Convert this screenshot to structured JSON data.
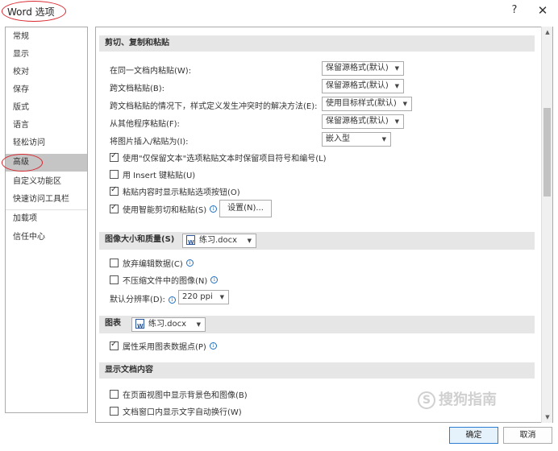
{
  "window": {
    "title": "Word 选项",
    "help_label": "?",
    "close_label": "✕"
  },
  "nav": {
    "items": [
      {
        "label": "常规"
      },
      {
        "label": "显示"
      },
      {
        "label": "校对"
      },
      {
        "label": "保存"
      },
      {
        "label": "版式"
      },
      {
        "label": "语言"
      },
      {
        "label": "轻松访问"
      },
      {
        "label": "高级",
        "selected": true
      },
      {
        "label": "自定义功能区"
      },
      {
        "label": "快速访问工具栏"
      },
      {
        "label": "加载项"
      },
      {
        "label": "信任中心"
      }
    ]
  },
  "cutpaste": {
    "header": "剪切、复制和粘贴",
    "rows": [
      {
        "label": "在同一文档内粘贴(W):",
        "value": "保留源格式(默认)"
      },
      {
        "label": "跨文档粘贴(B):",
        "value": "保留源格式(默认)"
      },
      {
        "label": "跨文档粘贴的情况下，样式定义发生冲突时的解决方法(E):",
        "value": "使用目标样式(默认)"
      },
      {
        "label": "从其他程序粘贴(F):",
        "value": "保留源格式(默认)"
      },
      {
        "label": "将图片插入/粘贴为(I):",
        "value": "嵌入型"
      }
    ],
    "checks": [
      {
        "label": "使用\"仅保留文本\"选项粘贴文本时保留项目符号和编号(L)",
        "checked": true
      },
      {
        "label": "用 Insert 键粘贴(U)",
        "checked": false
      },
      {
        "label": "粘贴内容时显示粘贴选项按钮(O)",
        "checked": true
      },
      {
        "label": "使用智能剪切和粘贴(S)",
        "checked": true
      }
    ],
    "settings_label": "设置(N)..."
  },
  "image": {
    "header": "图像大小和质量(S)",
    "doc": "练习.docx",
    "checks": [
      {
        "label": "放弃编辑数据(C)",
        "checked": false
      },
      {
        "label": "不压缩文件中的图像(N)",
        "checked": false
      }
    ],
    "resolution_label": "默认分辨率(D):",
    "resolution_value": "220 ppi"
  },
  "chart": {
    "header": "图表",
    "doc": "练习.docx",
    "checks": [
      {
        "label": "属性采用图表数据点(P)",
        "checked": true
      }
    ]
  },
  "display": {
    "header": "显示文档内容",
    "checks": [
      {
        "label": "在页面视图中显示背景色和图像(B)",
        "checked": false
      },
      {
        "label": "文档窗口内显示文字自动换行(W)",
        "checked": false
      }
    ]
  },
  "watermark": {
    "text": "搜狗指南",
    "logo": "S"
  },
  "footer": {
    "ok_label": "确定",
    "cancel_label": "取消"
  },
  "icons": {
    "info": "info-icon",
    "doc": "word-document-icon",
    "dropdown": "chevron-down-icon"
  },
  "colors": {
    "highlight_ellipse": "#d9272e",
    "selected_nav": "#c5c5c5",
    "section_header": "#e6e6e6",
    "primary_button_border": "#2b7cd3"
  }
}
